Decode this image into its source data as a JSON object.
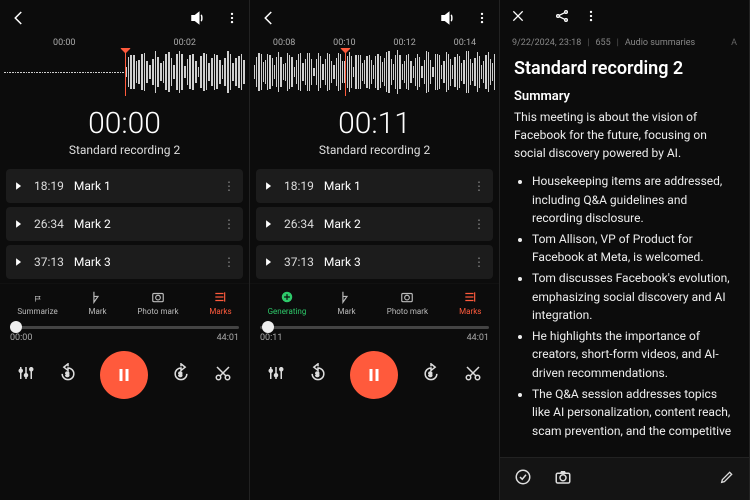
{
  "panel1": {
    "ticks": [
      "00:00",
      "00:02"
    ],
    "time": "00:00",
    "title": "Standard recording 2",
    "marks": [
      {
        "time": "18:19",
        "label": "Mark 1"
      },
      {
        "time": "26:34",
        "label": "Mark 2"
      },
      {
        "time": "37:13",
        "label": "Mark 3"
      }
    ],
    "toolbar": {
      "summarize": "Summarize",
      "mark": "Mark",
      "photomark": "Photo mark",
      "marks": "Marks"
    },
    "slider": {
      "start": "00:00",
      "end": "44:01"
    }
  },
  "panel2": {
    "ticks": [
      "00:08",
      "00:10",
      "00:12",
      "00:14"
    ],
    "time": "00:11",
    "title": "Standard recording 2",
    "marks": [
      {
        "time": "18:19",
        "label": "Mark 1"
      },
      {
        "time": "26:34",
        "label": "Mark 2"
      },
      {
        "time": "37:13",
        "label": "Mark 3"
      }
    ],
    "toolbar": {
      "generating": "Generating",
      "mark": "Mark",
      "photomark": "Photo mark",
      "marks": "Marks"
    },
    "slider": {
      "start": "00:11",
      "end": "44:01"
    }
  },
  "panel3": {
    "meta": {
      "date": "9/22/2024, 23:18",
      "count": "655",
      "section": "Audio summaries"
    },
    "heading": "Standard recording 2",
    "summary_label": "Summary",
    "summary_text": "This meeting is about the vision of Facebook for the future, focusing on social discovery powered by AI.",
    "bullets": [
      "Housekeeping items are addressed, including Q&A guidelines and recording disclosure.",
      "Tom Allison, VP of Product for Facebook at Meta, is welcomed.",
      "Tom discusses Facebook's evolution, emphasizing social discovery and AI integration.",
      "He highlights the importance of creators, short-form videos, and AI-driven recommendations.",
      "The Q&A session addresses topics like AI personalization, content reach, scam prevention, and the competitive"
    ]
  }
}
